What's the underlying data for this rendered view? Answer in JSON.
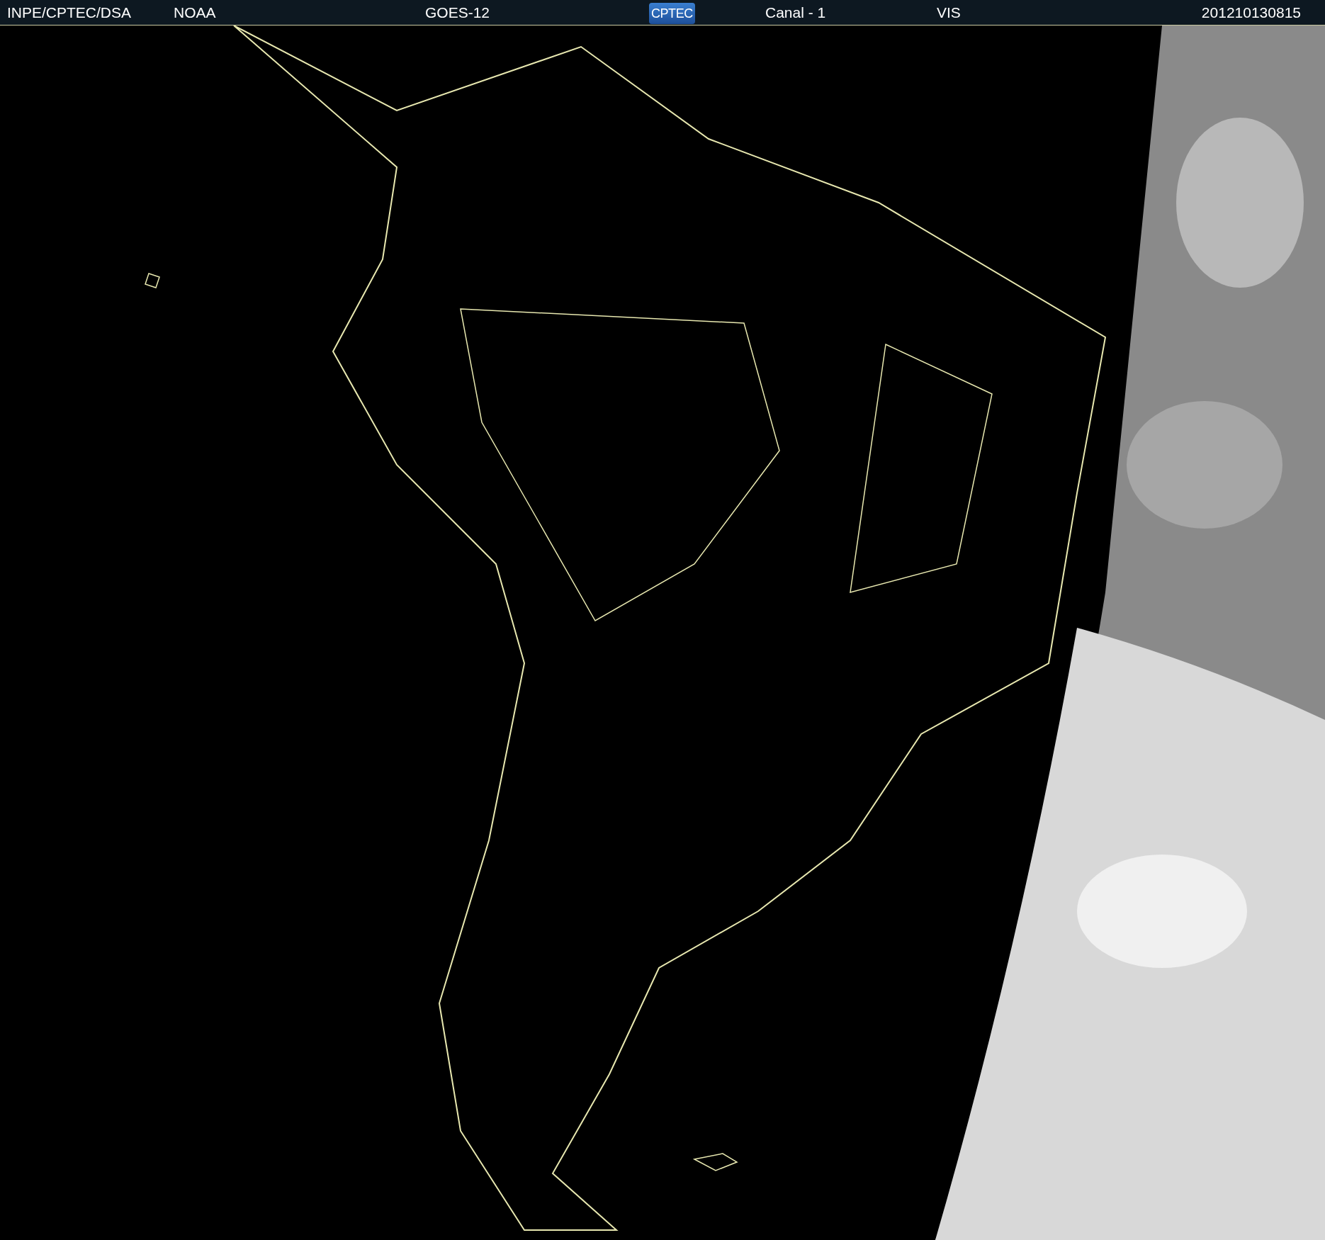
{
  "header": {
    "items": [
      {
        "kind": "text",
        "label": "INPE/CPTEC/DSA"
      },
      {
        "kind": "text",
        "label": "NOAA"
      },
      {
        "kind": "text",
        "label": "GOES-12"
      },
      {
        "kind": "logo",
        "label": "CPTEC"
      },
      {
        "kind": "text",
        "label": "Canal - 1"
      },
      {
        "kind": "text",
        "label": "VIS"
      },
      {
        "kind": "text",
        "label": "201210130815"
      }
    ]
  }
}
